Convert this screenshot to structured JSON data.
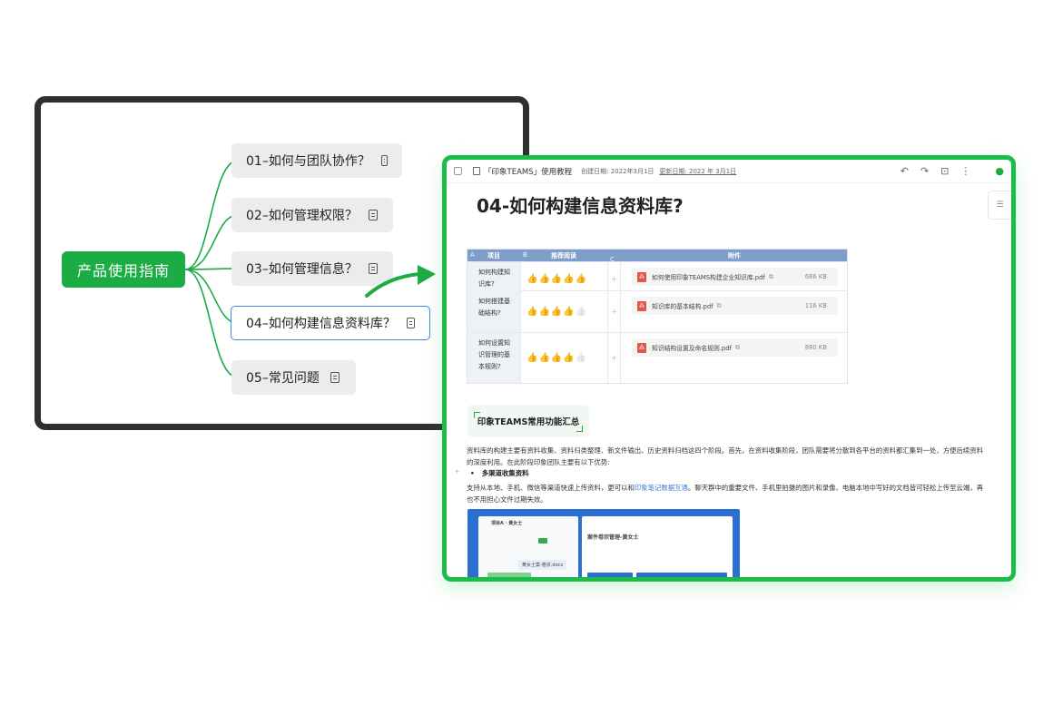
{
  "mindmap": {
    "root": "产品使用指南",
    "nodes": [
      "01–如何与团队协作？",
      "02–如何管理权限？",
      "03–如何管理信息？",
      "04–如何构建信息资料库？",
      "05–常见问题"
    ],
    "active_index": 3,
    "node_icon": "note-icon"
  },
  "app": {
    "notebook": "「印象TEAMS」使用教程",
    "created": "创建日期: 2022年3月1日",
    "updated": "更新日期: 2022 年 3月1日",
    "toolbar_icons": [
      "undo-icon",
      "redo-icon",
      "present-icon",
      "more-icon",
      "share-icon"
    ],
    "doc_title": "04-如何构建信息资料库?",
    "table": {
      "col_codes": [
        "A",
        "B",
        "C"
      ],
      "headers": [
        "项目",
        "推荐阅读",
        "附件"
      ],
      "rows": [
        {
          "item": "如何构建知识库?",
          "rating": 5,
          "file": "如何使用印象TEAMS构建企业知识库.pdf",
          "size": "686 KB"
        },
        {
          "item": "如何搭建基础结构?",
          "rating": 4,
          "file": "知识库的基本结构.pdf",
          "size": "116 KB"
        },
        {
          "item": "如何设置知识管理的基本规则?",
          "rating": 4,
          "file": "知识结构设置及命名规则.pdf",
          "size": "880 KB"
        }
      ]
    },
    "section_heading": "印象TEAMS常用功能汇总",
    "para1": "资料库的构建主要有资料收集、资料归类整理、新文件输出、历史资料归档这四个阶段。首先，在资料收集阶段，团队需要将分散到各平台的资料都汇集到一处，方便后续资料的深度利用。在此阶段印象团队主要有以下优势:",
    "bullet1": "多渠道收集资料",
    "para2_pre": "支持从本地、手机、微信等渠道快速上传资料，更可以和",
    "para2_link": "印象笔记数据互通",
    "para2_post": "。聊天群中的重要文件、手机里拍摄的图片和录像、电脑本地中写好的文档皆可轻松上传至云端，再也不用担心文件过期失效。",
    "shot": {
      "left_title": "项目A · 黄女士",
      "right_title": "案件卷宗管理-黄女士",
      "file_name": "黄女士案-卷宗.docx"
    }
  },
  "colors": {
    "brand_green": "#1bac43",
    "window_border_green": "#1bbd48",
    "mindmap_frame": "#2f2f33",
    "table_header": "#7e9dc8",
    "active_node_border": "#3a8ae0",
    "link_blue": "#3e7bd8",
    "pdf_red": "#e2574c"
  }
}
